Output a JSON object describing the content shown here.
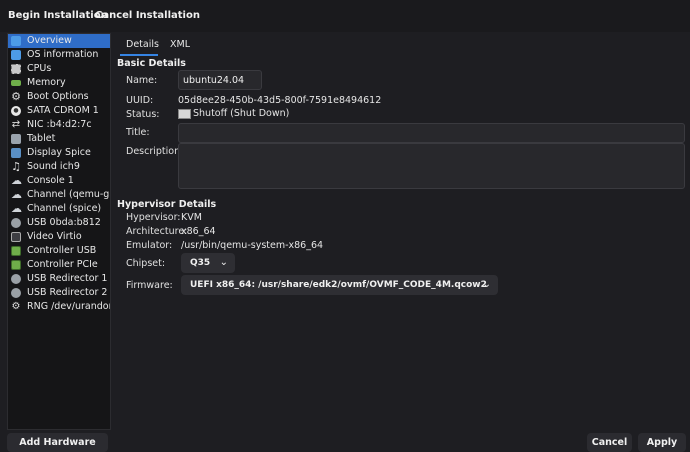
{
  "header": {
    "begin_label": "Begin Installation",
    "cancel_label": "Cancel Installation"
  },
  "sidebar": {
    "items": [
      {
        "label": "Overview",
        "icon": "monitor-icon",
        "selected": true
      },
      {
        "label": "OS information",
        "icon": "monitor-icon"
      },
      {
        "label": "CPUs",
        "icon": "cpu-icon"
      },
      {
        "label": "Memory",
        "icon": "memory-icon"
      },
      {
        "label": "Boot Options",
        "icon": "gear-icon"
      },
      {
        "label": "SATA CDROM 1",
        "icon": "cdrom-icon"
      },
      {
        "label": "NIC :b4:d2:7c",
        "icon": "network-icon"
      },
      {
        "label": "Tablet",
        "icon": "tablet-icon"
      },
      {
        "label": "Display Spice",
        "icon": "display-icon"
      },
      {
        "label": "Sound ich9",
        "icon": "sound-icon"
      },
      {
        "label": "Console 1",
        "icon": "cloud-icon"
      },
      {
        "label": "Channel (qemu-ga)",
        "icon": "cloud-icon"
      },
      {
        "label": "Channel (spice)",
        "icon": "cloud-icon"
      },
      {
        "label": "USB 0bda:b812",
        "icon": "usb-icon"
      },
      {
        "label": "Video Virtio",
        "icon": "video-icon"
      },
      {
        "label": "Controller USB",
        "icon": "controller-icon"
      },
      {
        "label": "Controller PCIe",
        "icon": "controller-icon"
      },
      {
        "label": "USB Redirector 1",
        "icon": "usb-icon"
      },
      {
        "label": "USB Redirector 2",
        "icon": "usb-icon"
      },
      {
        "label": "RNG /dev/urandom",
        "icon": "rng-icon"
      }
    ],
    "add_hardware_label": "Add Hardware"
  },
  "tabs": [
    {
      "label": "Details"
    },
    {
      "label": "XML"
    }
  ],
  "basic": {
    "title": "Basic Details",
    "name_label": "Name:",
    "name_value": "ubuntu24.04",
    "uuid_label": "UUID:",
    "uuid_value": "05d8ee28-450b-43d5-800f-7591e8494612",
    "status_label": "Status:",
    "status_value": "Shutoff (Shut Down)",
    "title_label": "Title:",
    "title_value": "",
    "description_label": "Description:",
    "description_value": ""
  },
  "hypervisor": {
    "title": "Hypervisor Details",
    "hypervisor_label": "Hypervisor:",
    "hypervisor_value": "KVM",
    "architecture_label": "Architecture:",
    "architecture_value": "x86_64",
    "emulator_label": "Emulator:",
    "emulator_value": "/usr/bin/qemu-system-x86_64",
    "chipset_label": "Chipset:",
    "chipset_value": "Q35",
    "firmware_label": "Firmware:",
    "firmware_value": "UEFI x86_64: /usr/share/edk2/ovmf/OVMF_CODE_4M.qcow2"
  },
  "footer": {
    "cancel_label": "Cancel",
    "apply_label": "Apply"
  },
  "colors": {
    "accent": "#3584e4",
    "selected": "#2f6dc8",
    "background": "#1e1e22"
  }
}
